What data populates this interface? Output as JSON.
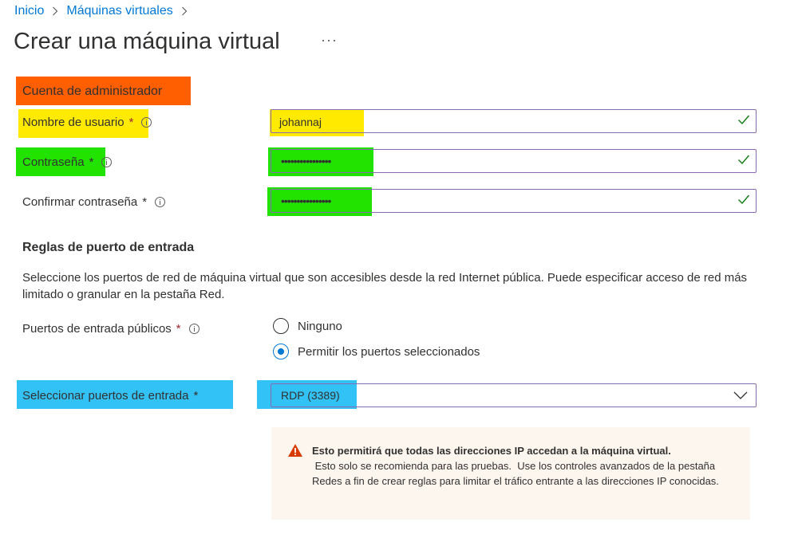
{
  "breadcrumb": {
    "home": "Inicio",
    "section": "Máquinas virtuales"
  },
  "page": {
    "title": "Crear una máquina virtual",
    "more": "···"
  },
  "admin": {
    "section_title": "Cuenta de administrador",
    "username_label": "Nombre de usuario",
    "username_value": "johannaj",
    "password_label": "Contraseña",
    "password_value": "••••••••••••••••",
    "confirm_label": "Confirmar contraseña",
    "confirm_value": "••••••••••••••••",
    "required_mark": "*"
  },
  "inbound": {
    "section_title": "Reglas de puerto de entrada",
    "description": "Seleccione los puertos de red de máquina virtual que son accesibles desde la red Internet pública. Puede especificar acceso de red más limitado o granular en la pestaña Red.",
    "public_ports_label": "Puertos de entrada públicos",
    "options": [
      "Ninguno",
      "Permitir los puertos seleccionados"
    ],
    "selected_option": "Permitir los puertos seleccionados",
    "select_ports_label": "Seleccionar puertos de entrada",
    "select_ports_value": "RDP (3389)"
  },
  "warning": {
    "title": "Esto permitirá que todas las direcciones IP accedan a la máquina virtual.",
    "text": " Esto solo se recomienda para las pruebas.  Use los controles avanzados de la pestaña Redes a fin de crear reglas para limitar el tráfico entrante a las direcciones IP conocidas."
  },
  "colors": {
    "accent": "#0078d4",
    "highlight_orange": "#ff5f00",
    "highlight_yellow": "#ffea00",
    "highlight_green": "#22e300",
    "highlight_blue": "#33c2f5",
    "valid_check": "#107c10",
    "warning_icon": "#d83b01"
  },
  "icons": [
    "chevron-right-icon",
    "info-icon",
    "checkmark-icon",
    "chevron-down-icon",
    "warning-icon"
  ]
}
